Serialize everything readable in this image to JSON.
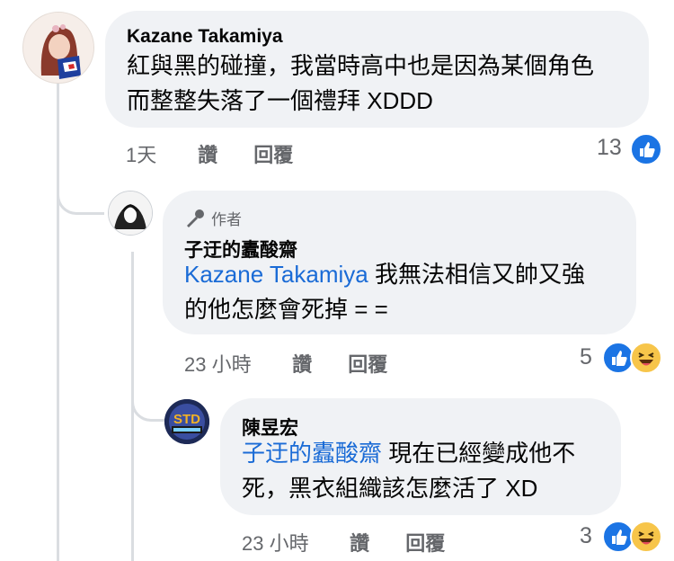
{
  "comments": [
    {
      "author": "Kazane Takamiya",
      "text_line1": "紅與黑的碰撞，我當時高中也是因為某個角色",
      "text_line2": "而整整失落了一個禮拜 XDDD",
      "time": "1天",
      "like": "讚",
      "reply": "回覆",
      "reaction_count": "13"
    },
    {
      "author_badge": "作者",
      "author": "子迂的蠹酸齋",
      "mention": "Kazane Takamiya",
      "text_after_mention": " 我無法相信又帥又強",
      "text_line2": "的他怎麼會死掉 = =",
      "time": "23 小時",
      "like": "讚",
      "reply": "回覆",
      "reaction_count": "5"
    },
    {
      "author": "陳昱宏",
      "mention": "子迂的蠹酸齋",
      "text_after_mention": " 現在已經變成他不",
      "text_line2": "死，黑衣組織該怎麼活了 XD",
      "time": "23 小時",
      "like": "讚",
      "reply": "回覆",
      "reaction_count": "3"
    }
  ],
  "icons": {
    "like": "like-reaction-icon",
    "haha": "haha-reaction-icon",
    "author_badge": "microphone-icon"
  },
  "colors": {
    "mention": "#1a6bd6",
    "bubble": "#f0f2f5",
    "like_blue": "#1b74e4"
  }
}
